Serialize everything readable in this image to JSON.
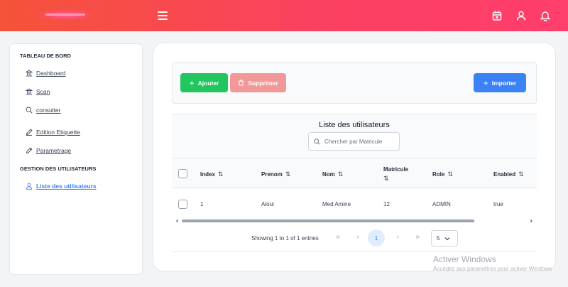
{
  "header": {
    "icons": [
      "menu-icon",
      "calendar-icon",
      "user-icon",
      "bell-icon"
    ]
  },
  "sidebar": {
    "sections": [
      {
        "title": "TABLEAU DE BORD",
        "items": [
          {
            "label": "Dashboard",
            "icon": "bank-icon"
          },
          {
            "label": "Scan",
            "icon": "bank-icon"
          },
          {
            "label": "consulter",
            "icon": "search-icon"
          },
          {
            "label": "Edition Etiquette",
            "icon": "pencil-icon"
          },
          {
            "label": "Parametrage",
            "icon": "edit-icon"
          }
        ]
      },
      {
        "title": "GESTION DES UTILISATEURS",
        "items": [
          {
            "label": "Liste des utilisateurs",
            "icon": "user-icon",
            "active": true
          }
        ]
      }
    ]
  },
  "toolbar": {
    "add_label": "Ajouter",
    "delete_label": "Supprimer",
    "import_label": "Importer"
  },
  "table": {
    "title": "Liste des utilisateurs",
    "search_placeholder": "Chercher par Matricule",
    "columns": [
      "Index",
      "Prenom",
      "Nom",
      "Matricule",
      "Role",
      "Enabled"
    ],
    "sort_glyph": "⇅",
    "rows": [
      {
        "index": "1",
        "prenom": "Aloui",
        "nom": "Med Amine",
        "matricule": "12",
        "role": "ADMIN",
        "enabled": "true"
      }
    ]
  },
  "paginator": {
    "report": "Showing 1 to 1 of 1 entries",
    "current_page": "1",
    "rows_per_page": "5",
    "controls": {
      "first": "«",
      "prev": "‹",
      "next": "›",
      "last": "»"
    }
  },
  "watermark": {
    "line1": "Activer Windows",
    "line2": "Accédez aux paramètres pour activer Windows"
  },
  "colors": {
    "header_gradient_start": "#f5533a",
    "header_gradient_end": "#ff3e6c",
    "add_button": "#22c55e",
    "delete_button": "#f19999",
    "import_button": "#3b82f6",
    "active_link": "#3b82f6"
  }
}
